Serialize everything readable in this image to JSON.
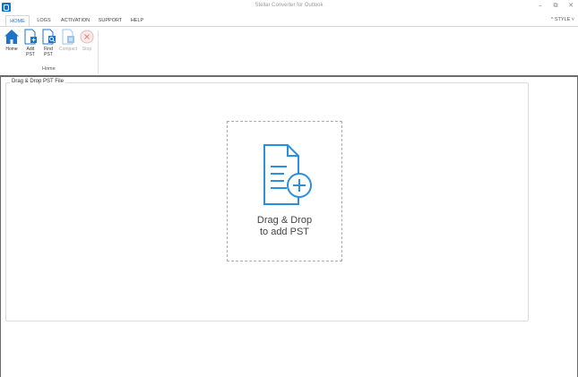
{
  "window": {
    "title": "Stellar Converter for Outlook",
    "minimize": "–",
    "maximize": "⧉",
    "close": "✕"
  },
  "tabs": [
    {
      "label": "HOME",
      "active": true
    },
    {
      "label": "LOGS"
    },
    {
      "label": "ACTIVATION"
    },
    {
      "label": "SUPPORT"
    },
    {
      "label": "HELP"
    }
  ],
  "style_menu": "^ STYLE ˅",
  "ribbon": {
    "buttons": [
      {
        "label_line1": "Home",
        "label_line2": "",
        "icon": "house-icon",
        "enabled": true
      },
      {
        "label_line1": "Add",
        "label_line2": "PST",
        "icon": "add-pst-icon",
        "enabled": true
      },
      {
        "label_line1": "Find",
        "label_line2": "PST",
        "icon": "find-pst-icon",
        "enabled": true
      },
      {
        "label_line1": "Compact",
        "label_line2": "",
        "icon": "compact-icon",
        "enabled": false
      },
      {
        "label_line1": "Stop",
        "label_line2": "",
        "icon": "stop-icon",
        "enabled": false
      }
    ],
    "group_label": "Home"
  },
  "main": {
    "group_title": "Drag & Drop PST File",
    "dropzone_line1": "Drag & Drop",
    "dropzone_line2": "to add PST"
  },
  "colors": {
    "accent": "#1d73c9",
    "icon_blue": "#2b8fe0",
    "disabled": "#aaaaaa"
  }
}
